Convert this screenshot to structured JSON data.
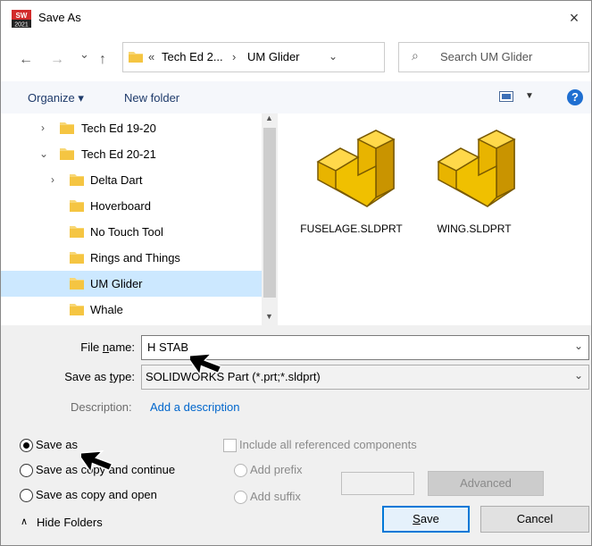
{
  "window": {
    "title": "Save As",
    "close": "×",
    "app_badge": "2021"
  },
  "nav": {
    "back": "←",
    "forward": "→",
    "recent": "⌄",
    "up": "↑",
    "breadcrumb": [
      "Tech Ed 2...",
      "UM Glider"
    ],
    "breadcrumb_prefix": "«",
    "sep": "›",
    "search_placeholder": "Search UM Glider"
  },
  "toolbar": {
    "organize": "Organize ▾",
    "new_folder": "New folder",
    "help": "?"
  },
  "tree": [
    {
      "label": "Tech Ed 19-20",
      "chevron": "›"
    },
    {
      "label": "Tech Ed 20-21",
      "chevron": "⌄"
    },
    {
      "label": "Delta Dart",
      "chevron": "›"
    },
    {
      "label": "Hoverboard",
      "chevron": ""
    },
    {
      "label": "No Touch Tool",
      "chevron": ""
    },
    {
      "label": "Rings and Things",
      "chevron": ""
    },
    {
      "label": "UM Glider",
      "chevron": ""
    },
    {
      "label": "Whale",
      "chevron": ""
    }
  ],
  "files": [
    {
      "name": "FUSELAGE.SLDPRT"
    },
    {
      "name": "WING.SLDPRT"
    }
  ],
  "form": {
    "filename_label_pre": "File ",
    "filename_label_key": "n",
    "filename_label_post": "ame:",
    "filename_value": "H STAB",
    "savetype_label_pre": "Save as ",
    "savetype_label_key": "t",
    "savetype_label_post": "ype:",
    "savetype_value": "SOLIDWORKS Part (*.prt;*.sldprt)",
    "description_label": "Description:",
    "description_link": "Add a description"
  },
  "options": {
    "save_as": "Save as",
    "save_as_copy_continue": "Save as copy and continue",
    "save_as_copy_open": "Save as copy and open",
    "include_refs": "Include all referenced components",
    "add_prefix": "Add prefix",
    "add_suffix": "Add suffix",
    "advanced": "Advanced"
  },
  "footer": {
    "hide_folders": "Hide Folders",
    "save_pre": "",
    "save_key": "S",
    "save_post": "ave",
    "cancel": "Cancel"
  }
}
